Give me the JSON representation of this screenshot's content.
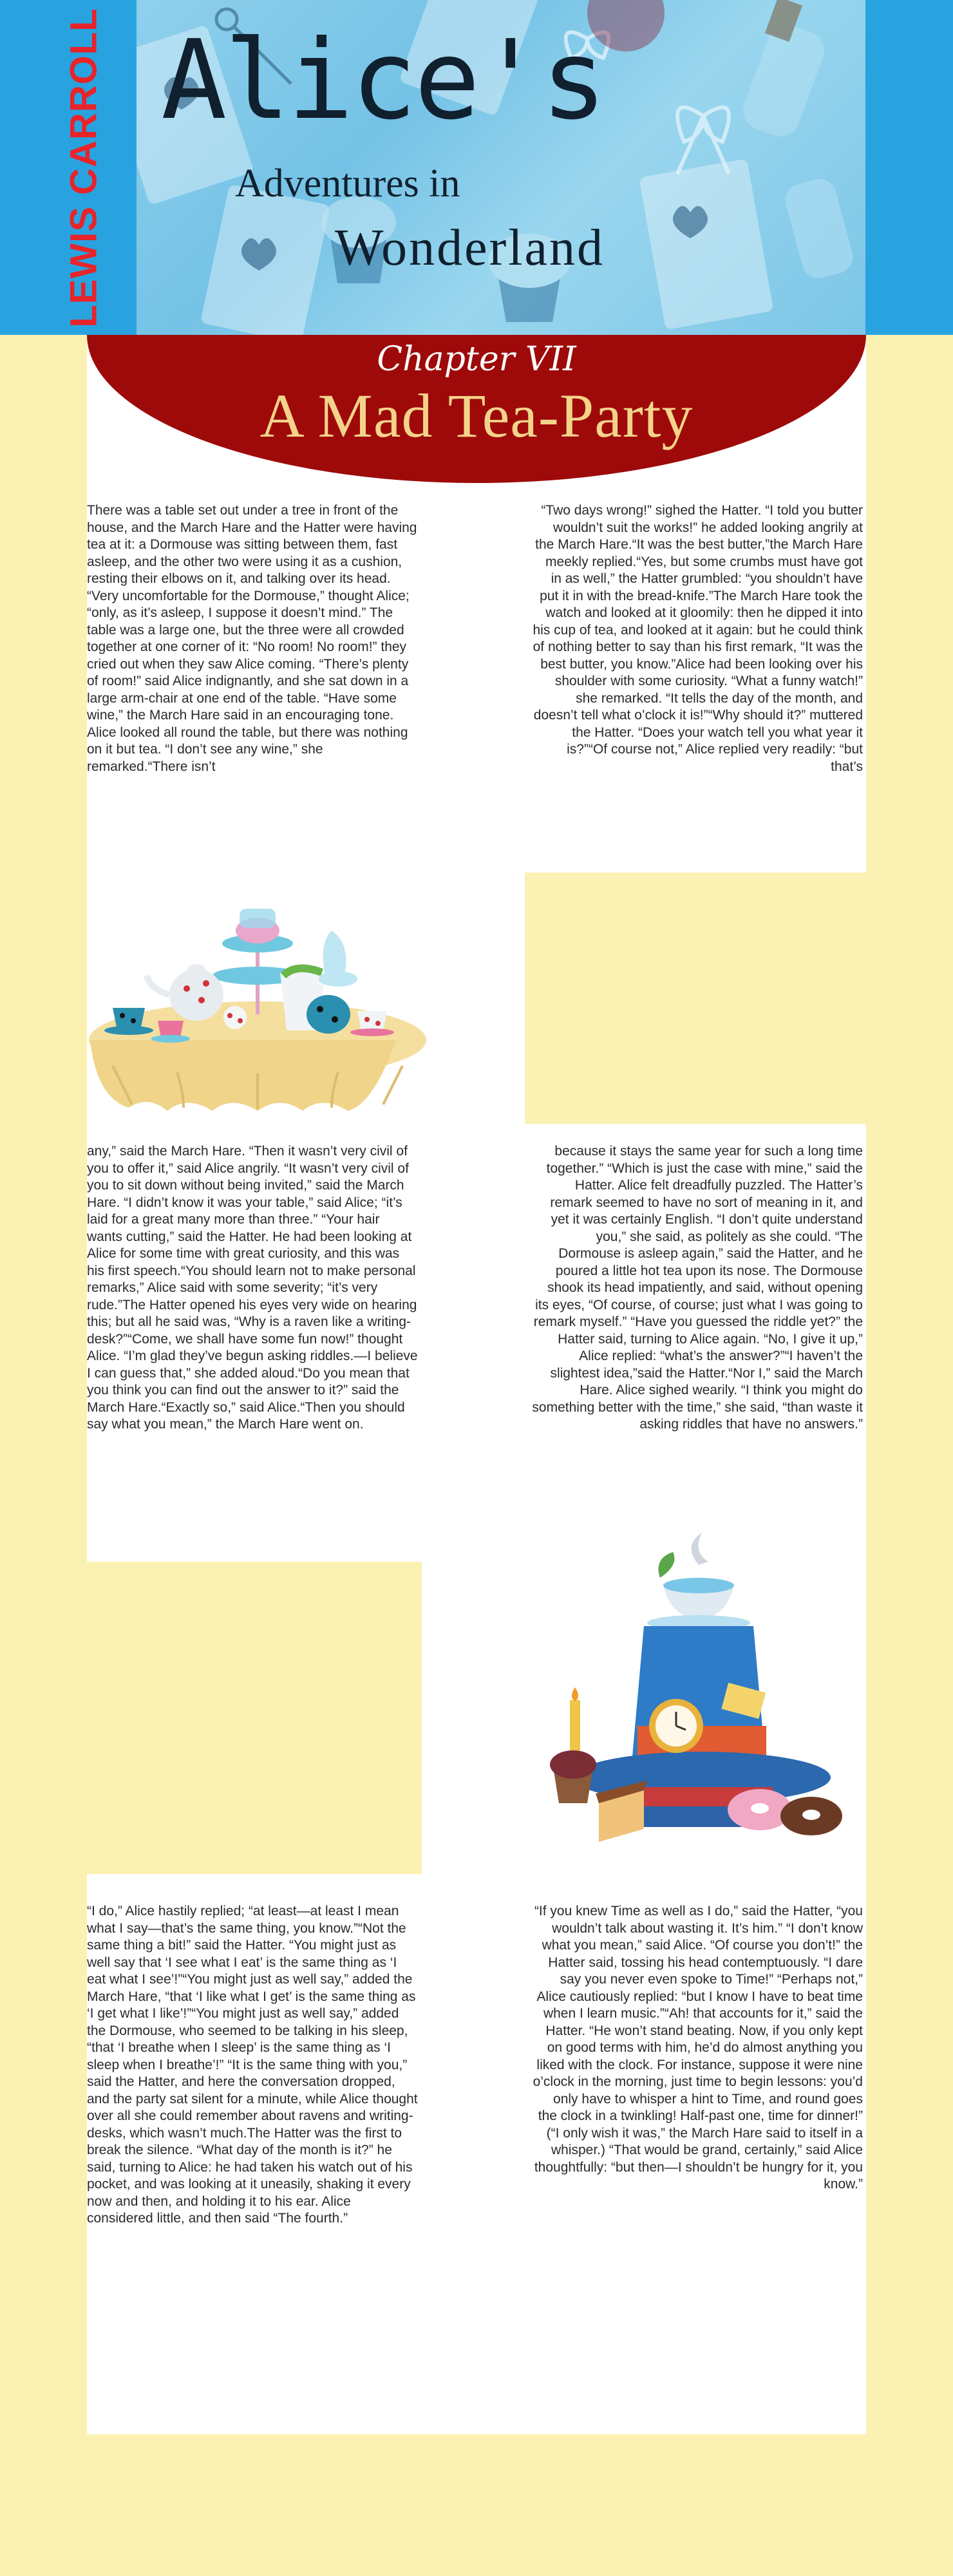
{
  "header": {
    "author": "LEWIS CARROLL",
    "title": "Alice's",
    "subtitle_line1": "Adventures in",
    "subtitle_line2": "Wonderland"
  },
  "chapter": {
    "number": "Chapter VII",
    "title": "A Mad Tea-Party"
  },
  "colors": {
    "banner_blue": "#29a3e0",
    "chapter_red": "#9e0a0a",
    "page_cream": "#fbf1b2",
    "author_red": "#e8232a"
  },
  "illustrations": {
    "tea_table": "tea-table-illustration",
    "hat_stack": "mad-hatter-hat-illustration"
  },
  "sections": {
    "s1_left": "There was a table set out under a tree in front of the house, and the March Hare and the Hatter were having tea at it: a Dormouse was sitting between them, fast asleep, and the other two were using it as a cushion, resting their elbows on it, and talking over its head. “Very uncomfortable for the Dormouse,” thought Alice; “only, as it’s asleep, I suppose it doesn’t mind.” The table was a large one, but the three were all crowded together at one corner of it: “No room! No room!” they cried out when they saw Alice coming. “There’s plenty of room!” said Alice indignantly, and she sat down in a large arm-chair at one end of the table. “Have some wine,” the March Hare said in an encouraging tone. Alice looked all round the table, but there was nothing on it but tea. “I don’t see any wine,” she remarked.“There isn’t",
    "s1_right": "“Two days wrong!” sighed the Hatter. “I told you butter wouldn’t suit the works!” he added looking angrily at the March Hare.“It was the best butter,”the March Hare meekly replied.“Yes, but some crumbs must have got in as well,” the Hatter grumbled: “you shouldn’t have put it in with the bread-knife.”The March Hare took the watch and looked at it gloomily: then he dipped it into his cup of tea, and looked at it again: but he could think of nothing better to say than his first remark, “It was the best butter, you know.”Alice had been looking over his shoulder with some curiosity. “What a funny watch!” she remarked. “It tells the day of the month, and doesn’t tell what o’clock it is!”“Why should it?” muttered the Hatter. “Does your watch tell you what year it is?”“Of course not,” Alice replied very readily: “but that’s",
    "s2_left": " any,” said the March Hare. “Then it wasn’t very civil of you to offer it,” said Alice angrily. “It wasn’t very civil of you to sit down without being invited,” said the March Hare. “I didn’t know it was your table,” said Alice; “it’s laid for a great many more than three.” “Your hair wants cutting,” said the Hatter. He had been looking at Alice for some time with great curiosity, and this was his first speech.“You should learn not to make personal remarks,” Alice said with some severity; “it’s very rude.”The Hatter opened his eyes very wide on hearing this; but all he said was, “Why is a raven like a writing-desk?”“Come, we shall have some fun now!” thought Alice. “I’m glad they’ve begun asking riddles.—I believe I can guess that,” she added aloud.“Do you mean that you think you can find out the answer to it?” said the March Hare.“Exactly so,” said Alice.“Then you should say what you mean,” the March Hare went on.",
    "s2_right": "because it stays the same year for such a long time together.” “Which is just the case with mine,” said the Hatter. Alice felt dreadfully puzzled. The Hatter’s remark seemed to have no sort of meaning in it, and yet it was certainly English. “I don’t quite understand you,” she said, as politely as she could. “The Dormouse is asleep again,” said the Hatter, and he poured a little hot tea upon its nose. The Dormouse shook its head impatiently, and said, without opening its eyes, “Of course, of course; just what I was going to remark myself.” “Have you guessed the riddle yet?” the Hatter said, turning to Alice again. “No, I give it up,” Alice replied: “what’s the answer?”“I haven’t the slightest idea,”said the Hatter.“Nor I,” said the March Hare. Alice sighed wearily. “I think you might do something better with the time,” she said, “than waste it asking riddles that have no answers.”",
    "s3_left": "“I do,” Alice hastily replied; “at least—at least I mean what I say—that’s the same thing, you know.”“Not the same thing a bit!” said the Hatter. “You might just as well say that ‘I see what I eat’ is the same thing as ‘I eat what I see’!”“You might just as well say,” added the March Hare, “that ‘I like what I get’ is the same thing as ‘I get what I like’!”“You might just as well say,” added the Dormouse, who seemed to be talking in his sleep, “that ‘I breathe when I sleep’ is the same thing as ‘I sleep when I breathe’!” “It is the same thing with you,” said the Hatter, and here the conversation dropped, and the party sat silent for a minute, while Alice thought over all she could remember about ravens and writing-desks, which wasn’t much.The Hatter was the first to break the silence. “What day of the month is it?” he said, turning to Alice: he had taken his watch out of his pocket, and was looking at it uneasily, shaking it every now and then, and holding it to his ear. Alice considered little, and then said “The fourth.”",
    "s3_right": "“If you knew Time as well as I do,” said the Hatter, “you wouldn’t talk about wasting it. It’s him.” “I don’t know what you mean,” said Alice. “Of course you don’t!” the Hatter said, tossing his head contemptuously. “I dare say you never even spoke to Time!” “Perhaps not,” Alice cautiously replied: “but I know I have to beat time when I learn music.”“Ah! that accounts for it,” said the Hatter. “He won’t stand beating. Now, if you only kept on good terms with him, he’d do almost anything you liked with the clock. For instance, suppose it were nine o’clock in the morning, just time to begin lessons: you’d only have to whisper a hint to Time, and round goes the clock in a twinkling! Half-past one, time for dinner!” (“I only wish it was,” the March Hare said to itself in a whisper.) “That would be grand, certainly,” said Alice thoughtfully: “but then—I shouldn’t be hungry for it, you know.”"
  }
}
